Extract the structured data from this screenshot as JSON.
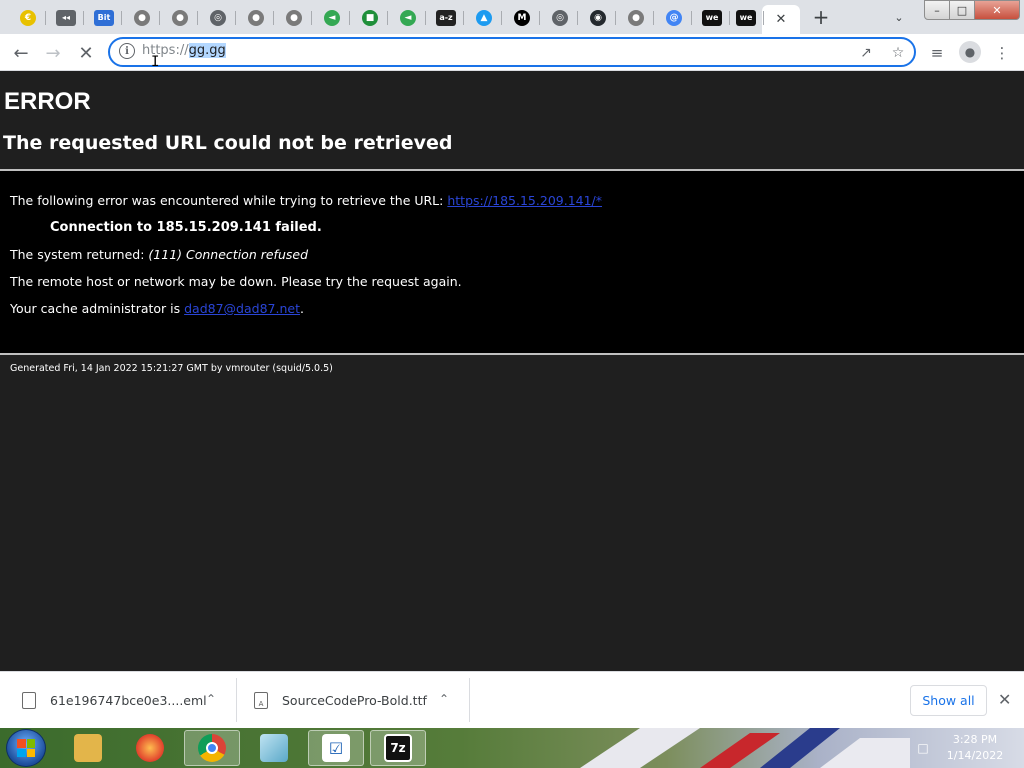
{
  "browser": {
    "tabs": [
      {
        "icon": "yellow-circle-icon",
        "glyph": "€",
        "color": "#e8c100"
      },
      {
        "icon": "speaker-icon",
        "glyph": "◂◂",
        "color": "#5f6368"
      },
      {
        "icon": "bit-icon",
        "glyph": "Bit",
        "color": "#2f6fd6"
      },
      {
        "icon": "globe-icon",
        "glyph": "●",
        "color": "#7a7a7a"
      },
      {
        "icon": "globe-icon",
        "glyph": "●",
        "color": "#7a7a7a"
      },
      {
        "icon": "chrome-icon",
        "glyph": "◎",
        "color": "#5f6368"
      },
      {
        "icon": "globe-icon",
        "glyph": "●",
        "color": "#7a7a7a"
      },
      {
        "icon": "globe-icon",
        "glyph": "●",
        "color": "#7a7a7a"
      },
      {
        "icon": "green-arrow-icon",
        "glyph": "◄",
        "color": "#34a853"
      },
      {
        "icon": "green-tag-icon",
        "glyph": "■",
        "color": "#1f8f3a"
      },
      {
        "icon": "green-arrow-icon",
        "glyph": "◄",
        "color": "#34a853"
      },
      {
        "icon": "az-icon",
        "glyph": "a-z",
        "color": "#222222"
      },
      {
        "icon": "twitter-icon",
        "glyph": "▲",
        "color": "#1d9bf0"
      },
      {
        "icon": "medium-icon",
        "glyph": "M",
        "color": "#000000"
      },
      {
        "icon": "chrome-icon",
        "glyph": "◎",
        "color": "#5f6368"
      },
      {
        "icon": "github-icon",
        "glyph": "◉",
        "color": "#24292e"
      },
      {
        "icon": "globe-icon",
        "glyph": "●",
        "color": "#7a7a7a"
      },
      {
        "icon": "at-icon",
        "glyph": "@",
        "color": "#4285f4"
      },
      {
        "icon": "we-icon",
        "glyph": "we",
        "color": "#111111"
      },
      {
        "icon": "we-icon",
        "glyph": "we",
        "color": "#111111"
      }
    ],
    "active_tab_close": "✕",
    "new_tab": "+",
    "tab_search": "⌄",
    "window_controls": {
      "minimize": "–",
      "maximize": "□",
      "close": "✕"
    },
    "omnibox": {
      "scheme": "https://",
      "host": "gg.gg"
    }
  },
  "page": {
    "title": "ERROR",
    "subtitle": "The requested URL could not be retrieved",
    "line1_text": "The following error was encountered while trying to retrieve the URL: ",
    "line1_link": "https://185.15.209.141/*",
    "line2": "Connection to 185.15.209.141 failed.",
    "line3_prefix": "The system returned: ",
    "line3_italic": "(111) Connection refused",
    "line4": "The remote host or network may be down. Please try the request again.",
    "line5_prefix": "Your cache administrator is ",
    "line5_link": "dad87@dad87.net",
    "line5_suffix": ".",
    "generated": "Generated Fri, 14 Jan 2022 15:21:27 GMT by vmrouter (squid/5.0.5)"
  },
  "downloads": {
    "items": [
      {
        "name": "61e196747bce0e3....eml"
      },
      {
        "name": "SourceCodePro-Bold.ttf"
      }
    ],
    "show_all": "Show all",
    "close": "✕"
  },
  "taskbar": {
    "clock_time": "3:28 PM",
    "clock_date": "1/14/2022"
  }
}
